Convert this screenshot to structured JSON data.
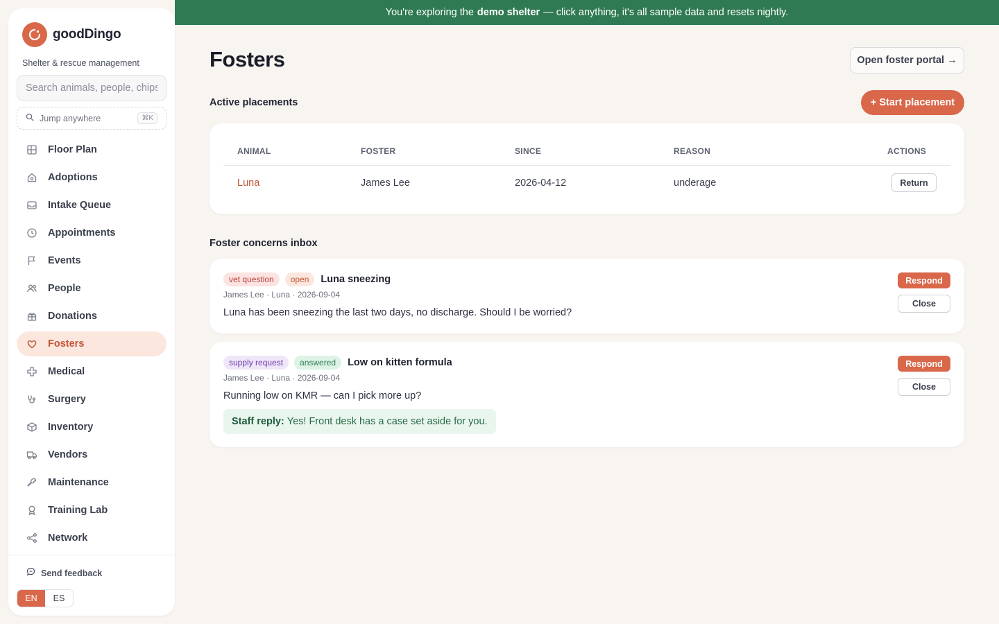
{
  "colors": {
    "accent": "#d9674a",
    "banner": "#2f7a52",
    "background": "#f8f5f1",
    "active_nav_bg": "#fbe7dd"
  },
  "sidebar": {
    "brand": "goodDingo",
    "tagline": "Shelter & rescue management",
    "search_placeholder": "Search animals, people, chips...",
    "jump_label": "Jump anywhere",
    "jump_shortcut": "⌘K",
    "nav": [
      {
        "label": "Floor Plan",
        "icon": "floor-plan-icon"
      },
      {
        "label": "Adoptions",
        "icon": "home-icon"
      },
      {
        "label": "Intake Queue",
        "icon": "inbox-icon"
      },
      {
        "label": "Appointments",
        "icon": "clock-icon"
      },
      {
        "label": "Events",
        "icon": "flag-icon"
      },
      {
        "label": "People",
        "icon": "people-icon"
      },
      {
        "label": "Donations",
        "icon": "gift-icon"
      },
      {
        "label": "Fosters",
        "icon": "heart-icon",
        "active": true
      },
      {
        "label": "Medical",
        "icon": "medical-cross-icon"
      },
      {
        "label": "Surgery",
        "icon": "stethoscope-icon"
      },
      {
        "label": "Inventory",
        "icon": "box-icon"
      },
      {
        "label": "Vendors",
        "icon": "truck-icon"
      },
      {
        "label": "Maintenance",
        "icon": "wrench-icon"
      },
      {
        "label": "Training Lab",
        "icon": "award-icon"
      },
      {
        "label": "Network",
        "icon": "share-icon"
      }
    ],
    "feedback_label": "Send feedback",
    "languages": [
      {
        "code": "EN",
        "active": true
      },
      {
        "code": "ES",
        "active": false
      }
    ]
  },
  "banner": {
    "before": "You're exploring the",
    "highlight": "demo shelter",
    "after": "— click anything, it's all sample data and resets nightly."
  },
  "page": {
    "title": "Fosters",
    "portal_button": "Open foster portal →"
  },
  "placements": {
    "section_title": "Active placements",
    "start_button": "+ Start placement",
    "columns": [
      "ANIMAL",
      "FOSTER",
      "SINCE",
      "REASON",
      "ACTIONS"
    ],
    "rows": [
      {
        "animal": "Luna",
        "foster": "James Lee",
        "since": "2026-04-12",
        "reason": "underage",
        "action": "Return"
      }
    ]
  },
  "concerns": {
    "section_title": "Foster concerns inbox",
    "items": [
      {
        "category": "vet question",
        "status": "open",
        "title": "Luna sneezing",
        "meta": "James Lee · Luna · 2026-09-04",
        "body": "Luna has been sneezing the last two days, no discharge. Should I be worried?",
        "respond": "Respond",
        "close": "Close"
      },
      {
        "category": "supply request",
        "status": "answered",
        "title": "Low on kitten formula",
        "meta": "James Lee · Luna · 2026-09-04",
        "body": "Running low on KMR — can I pick more up?",
        "reply_label": "Staff reply:",
        "reply_text": "Yes! Front desk has a case set aside for you.",
        "respond": "Respond",
        "close": "Close"
      }
    ]
  }
}
